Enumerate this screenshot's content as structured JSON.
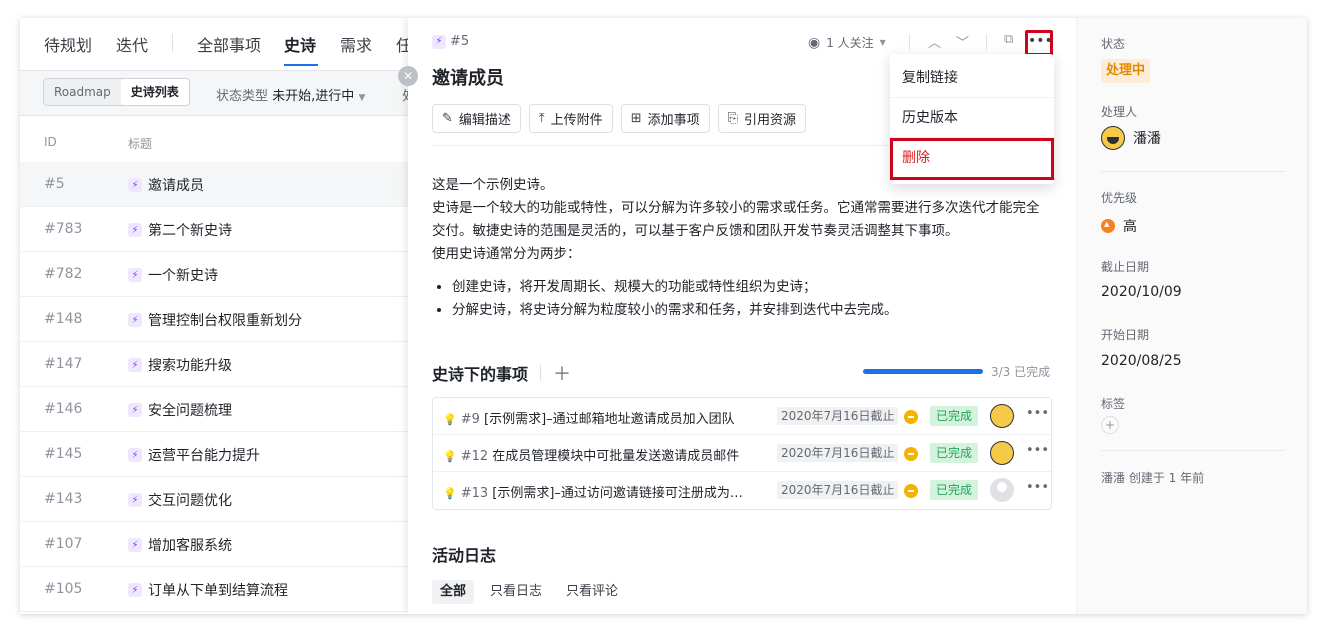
{
  "left_nav": {
    "tabs": [
      {
        "label": "待规划"
      },
      {
        "label": "迭代"
      },
      {
        "label": "全部事项"
      },
      {
        "label": "史诗"
      },
      {
        "label": "需求"
      },
      {
        "label": "任"
      }
    ],
    "view_toggle": {
      "roadmap": "Roadmap",
      "list": "史诗列表"
    },
    "filter_label": "状态类型",
    "filter_value": "未开始,进行中",
    "filter2_label": "处"
  },
  "table": {
    "col_id": "ID",
    "col_title": "标题",
    "rows": [
      {
        "id": "#5",
        "title": "邀请成员"
      },
      {
        "id": "#783",
        "title": "第二个新史诗"
      },
      {
        "id": "#782",
        "title": "一个新史诗"
      },
      {
        "id": "#148",
        "title": "管理控制台权限重新划分"
      },
      {
        "id": "#147",
        "title": "搜索功能升级"
      },
      {
        "id": "#146",
        "title": "安全问题梳理"
      },
      {
        "id": "#145",
        "title": "运营平台能力提升"
      },
      {
        "id": "#143",
        "title": "交互问题优化"
      },
      {
        "id": "#107",
        "title": "增加客服系统"
      },
      {
        "id": "#105",
        "title": "订单从下单到结算流程"
      }
    ]
  },
  "detail": {
    "epic_id": "#5",
    "watchers": "1 人关注",
    "title": "邀请成员",
    "actions": {
      "edit": "编辑描述",
      "upload": "上传附件",
      "add_item": "添加事项",
      "reference": "引用资源"
    },
    "description": {
      "line1": "这是一个示例史诗。",
      "line2": "史诗是一个较大的功能或特性，可以分解为许多较小的需求或任务。它通常需要进行多次迭代才能完全交付。敏捷史诗的范围是灵活的，可以基于客户反馈和团队开发节奏灵活调整其下事项。",
      "line3": "使用史诗通常分为两步：",
      "bullet1": "创建史诗，将开发周期长、规模大的功能或特性组织为史诗；",
      "bullet2": "分解史诗，将史诗分解为粒度较小的需求和任务，并安排到迭代中去完成。"
    },
    "sub_items_heading": "史诗下的事项",
    "progress_text": "3/3 已完成",
    "progress_fraction": 1.0,
    "sub_items": [
      {
        "id": "#9",
        "title": "[示例需求]–通过邮箱地址邀请成员加入团队",
        "due": "2020年7月16日截止",
        "status": "已完成"
      },
      {
        "id": "#12",
        "title": "在成员管理模块中可批量发送邀请成员邮件",
        "due": "2020年7月16日截止",
        "status": "已完成"
      },
      {
        "id": "#13",
        "title": "[示例需求]–通过访问邀请链接可注册成为…",
        "due": "2020年7月16日截止",
        "status": "已完成"
      }
    ],
    "activity_heading": "活动日志",
    "activity_tabs": [
      {
        "label": "全部"
      },
      {
        "label": "只看日志"
      },
      {
        "label": "只看评论"
      }
    ]
  },
  "menu": {
    "copy_link": "复制链接",
    "history": "历史版本",
    "delete": "删除"
  },
  "sidebar": {
    "status_label": "状态",
    "status_value": "处理中",
    "assignee_label": "处理人",
    "assignee_value": "潘潘",
    "priority_label": "优先级",
    "priority_value": "高",
    "due_label": "截止日期",
    "due_value": "2020/10/09",
    "start_label": "开始日期",
    "start_value": "2020/08/25",
    "tags_label": "标签",
    "creator": "潘潘 创建于 1 年前"
  },
  "colors": {
    "accent": "#1f6feb",
    "highlight": "#d0021b",
    "status_processing": "#e58a00",
    "status_done": "#23a35a"
  }
}
